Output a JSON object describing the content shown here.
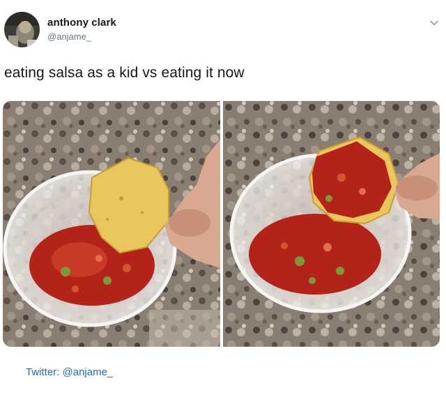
{
  "author": {
    "display_name": "anthony clark",
    "handle": "@anjame_",
    "avatar_icon": "profile-photo"
  },
  "tweet": {
    "text": "eating salsa as a kid vs eating it now"
  },
  "media": {
    "photos": [
      {
        "subject": "kid-photo",
        "dip_amount": "small"
      },
      {
        "subject": "now-photo",
        "dip_amount": "huge"
      }
    ]
  },
  "menu": {
    "icon": "chevron-down-icon"
  },
  "footer": {
    "credit": "Twitter: @anjame_"
  },
  "colors": {
    "link": "#1b6fa8",
    "handle": "#657786",
    "salsa": "#b3231a",
    "chip": "#e9c75c",
    "granite": "#8a7d72"
  }
}
